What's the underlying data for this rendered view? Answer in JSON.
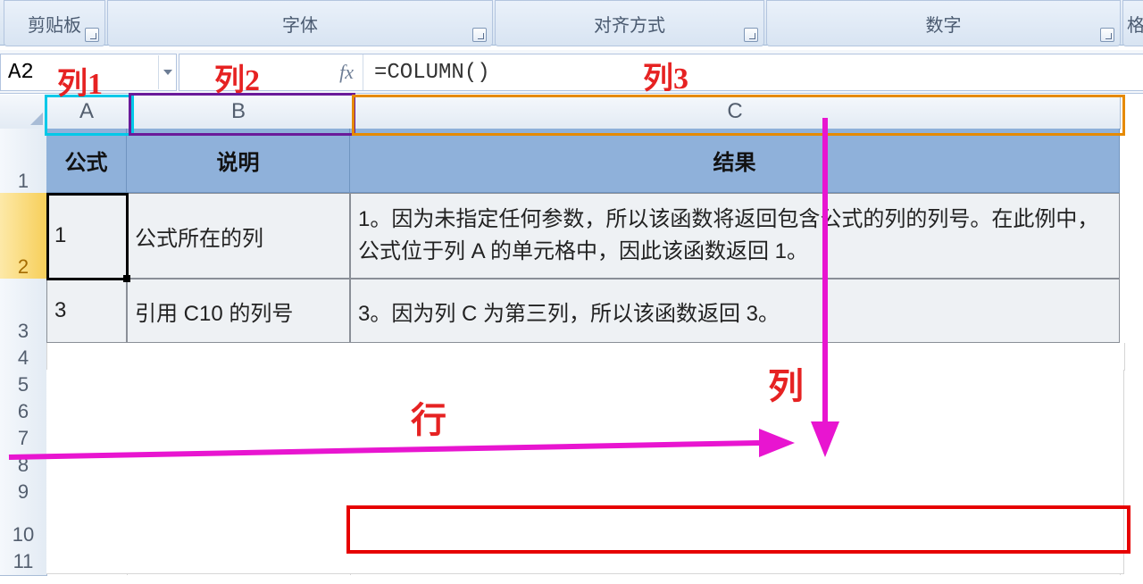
{
  "ribbon": {
    "groups": {
      "clipboard": "剪贴板",
      "font": "字体",
      "alignment": "对齐方式",
      "number": "数字",
      "format_partial": "格"
    }
  },
  "formula_bar": {
    "name_box_value": "A2",
    "fx_label": "fx",
    "formula": "=COLUMN()"
  },
  "columns": {
    "A": "A",
    "B": "B",
    "C": "C"
  },
  "rows": [
    "1",
    "2",
    "3",
    "4",
    "5",
    "6",
    "7",
    "8",
    "9",
    "10",
    "11"
  ],
  "table": {
    "headers": {
      "A": "公式",
      "B": "说明",
      "C": "结果"
    },
    "data": [
      {
        "A": "1",
        "B": "公式所在的列",
        "C": "1。因为未指定任何参数，所以该函数将返回包含公式的列的列号。在此例中，公式位于列 A 的单元格中，因此该函数返回 1。"
      },
      {
        "A": "3",
        "B": "引用 C10 的列号",
        "C": "3。因为列 C 为第三列，所以该函数返回 3。"
      }
    ]
  },
  "annotations": {
    "col1": "列1",
    "col2": "列2",
    "col3": "列3",
    "row_label": "行",
    "col_label": "列"
  },
  "colors": {
    "magenta": "#e815d0",
    "red": "#e60000",
    "cyan": "#00c8e8",
    "purple": "#6a1a9a",
    "orange": "#e68a00"
  }
}
